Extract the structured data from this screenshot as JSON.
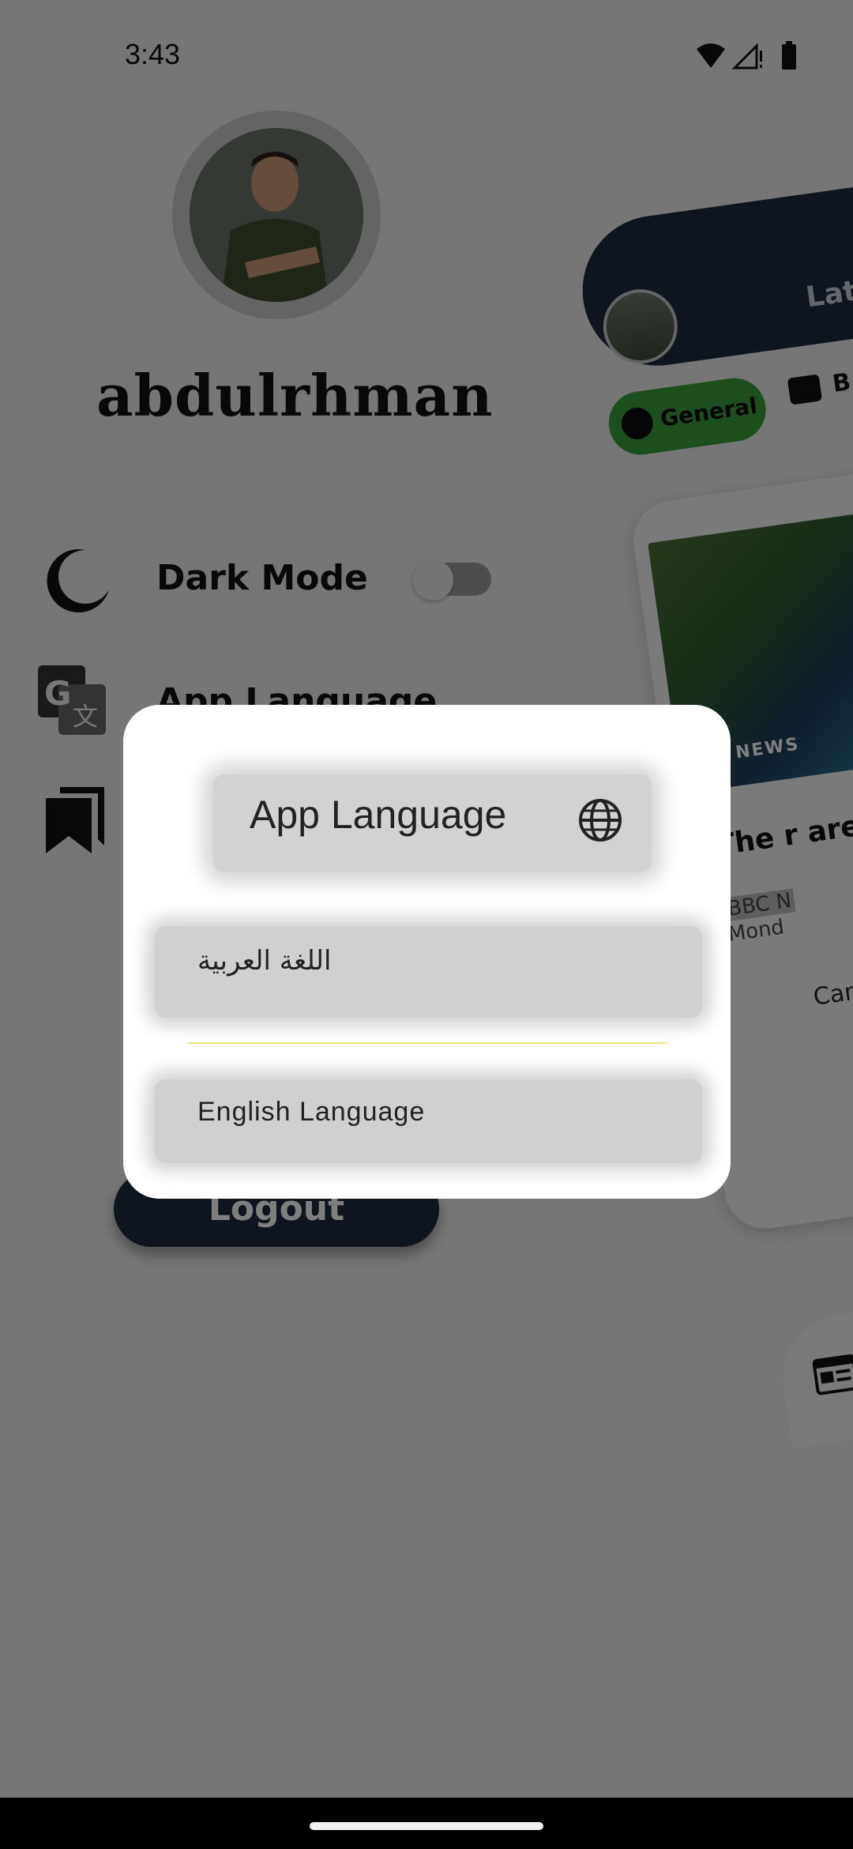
{
  "status_bar": {
    "time": "3:43"
  },
  "drawer": {
    "username": "abdulrhman",
    "menu": {
      "dark_mode_label": "Dark Mode",
      "dark_mode_on": false,
      "language_label": "App Language"
    },
    "logout_label": "Logout"
  },
  "preview": {
    "header_title": "Lates",
    "chips": {
      "general": "General",
      "business": "B"
    },
    "article": {
      "image_badge": "BBC NEWS",
      "title": "The r are c",
      "source": "BBC N",
      "date": "Mond",
      "description": "Cam nic min"
    }
  },
  "dialog": {
    "title": "App Language",
    "options": [
      "اللغة العربية",
      "English Language"
    ]
  },
  "colors": {
    "drawer_bg": "#ececec",
    "accent_dark": "#1c2a3c",
    "chip_green": "#3a9d3a",
    "divider_yellow": "#f1e07a"
  }
}
